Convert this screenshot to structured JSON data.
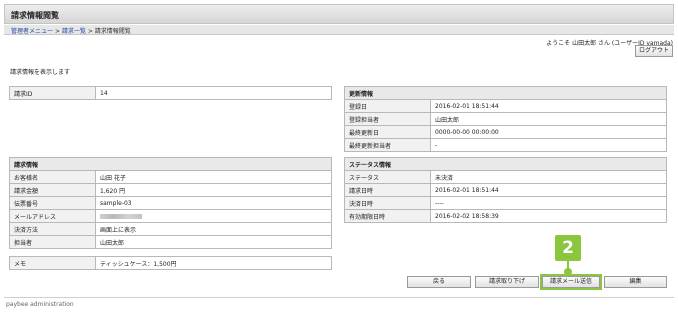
{
  "header": {
    "title": "請求情報閲覧"
  },
  "breadcrumb": {
    "items": [
      "管理者メニュー",
      "請求一覧"
    ],
    "current": "請求情報閲覧",
    "separator": ">"
  },
  "user": {
    "welcome": "ようこそ 山田太郎 さん (ユーザーID yamada)",
    "logout": "ログアウト"
  },
  "intro": "請求情報を表示します",
  "id_table": {
    "label": "請求ID",
    "value": "14"
  },
  "update_info": {
    "title": "更新情報",
    "rows": [
      {
        "label": "登録日",
        "value": "2016-02-01 18:51:44"
      },
      {
        "label": "登録担当者",
        "value": "山田太郎"
      },
      {
        "label": "最終更新日",
        "value": "0000-00-00 00:00:00"
      },
      {
        "label": "最終更新担当者",
        "value": "-"
      }
    ]
  },
  "billing_info": {
    "title": "請求情報",
    "rows": [
      {
        "label": "お客様名",
        "value": "山田 花子"
      },
      {
        "label": "請求金額",
        "value": "1,620 円"
      },
      {
        "label": "伝票番号",
        "value": "sample-03"
      },
      {
        "label": "メールアドレス",
        "value": ""
      },
      {
        "label": "決済方法",
        "value": "画面上に表示"
      },
      {
        "label": "担当者",
        "value": "山田太郎"
      }
    ]
  },
  "status_info": {
    "title": "ステータス情報",
    "rows": [
      {
        "label": "ステータス",
        "value": "未決済"
      },
      {
        "label": "請求日時",
        "value": "2016-02-01 18:51:44"
      },
      {
        "label": "決済日時",
        "value": "----"
      },
      {
        "label": "有効期限日時",
        "value": "2016-02-02 18:58:39"
      }
    ]
  },
  "memo": {
    "label": "メモ",
    "value": "ティッシュケース：1,500円"
  },
  "actions": {
    "back": "戻る",
    "cancel": "請求取り下げ",
    "send_mail": "請求メール送信",
    "edit": "編集"
  },
  "callout": {
    "number": "2",
    "color": "#8cc63f"
  },
  "footer": "paybee administration"
}
